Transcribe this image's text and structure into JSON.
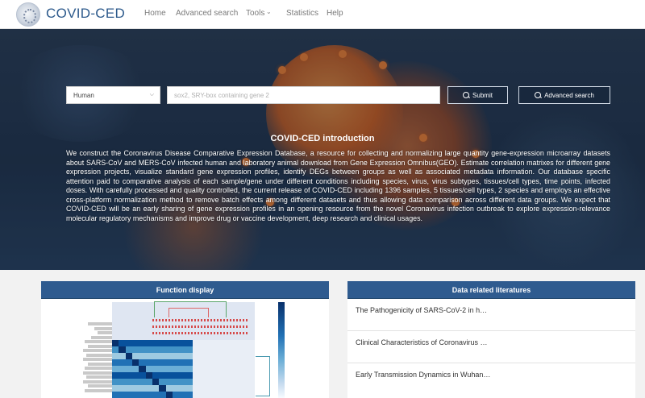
{
  "navbar": {
    "brand": "COVID-CED",
    "items": [
      {
        "label": "Home"
      },
      {
        "label": "Advanced search"
      },
      {
        "label": "Tools"
      },
      {
        "label": "Statistics"
      },
      {
        "label": "Help"
      }
    ],
    "tools_caret_icon": "chevron-down-icon"
  },
  "search": {
    "species_selected": "Human",
    "placeholder": "sox2, SRY-box containing gene 2",
    "submit_label": "Submit",
    "advanced_label": "Advanced search"
  },
  "intro": {
    "title": "COVID-CED introduction",
    "text": "We construct the Coronavirus Disease Comparative Expression Database, a resource for collecting and normalizing large quantity gene-expression microarray datasets about SARS-CoV and MERS-CoV infected human and laboratory animal download from Gene Expression Omnibus(GEO). Estimate correlation matrixes for different gene expression projects, visualize standard gene expression profiles, identify DEGs between groups as well as associated metadata information. Our database specific attention paid to comparative analysis of each sample/gene under different conditions including species, virus, virus subtypes, tissues/cell types, time points, infected doses. With carefully processed and quality controlled, the current release of COVID-CED including 1396 samples, 5 tissues/cell types, 2 species and employs an effective cross-platform normalization method to remove batch effects among different datasets and thus allowing data comparison across different data groups. We expect that COVID-CED will be an early sharing of gene expression profiles in an opening resource from the novel Coronavirus infection outbreak to explore expression-relevance molecular regulatory mechanisms and improve drug or vaccine development, deep research and clinical usages."
  },
  "function_panel": {
    "title": "Function display"
  },
  "literature_panel": {
    "title": "Data related literatures",
    "items": [
      {
        "label": "The Pathogenicity of SARS-CoV-2 in h…"
      },
      {
        "label": "Clinical Characteristics of Coronavirus …"
      },
      {
        "label": "Early Transmission Dynamics in Wuhan…"
      }
    ]
  },
  "colors": {
    "brand": "#2d5a8c",
    "panel_header": "#2f5b8f",
    "virus_orange": "#d96b2a"
  }
}
